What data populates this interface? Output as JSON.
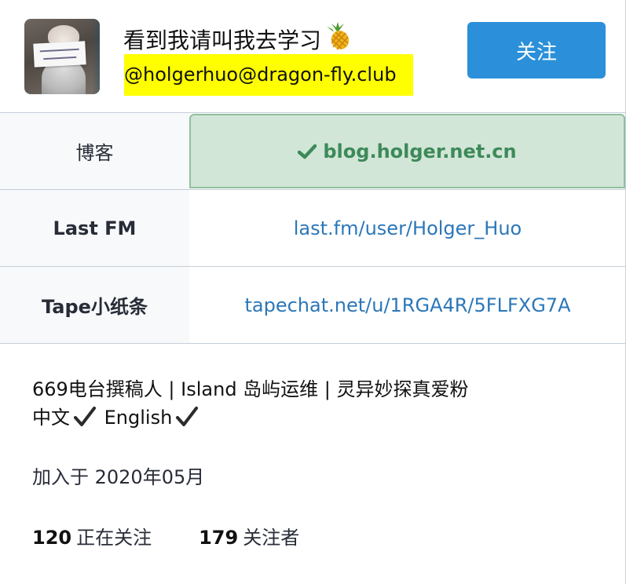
{
  "profile": {
    "display_name": "看到我请叫我去学习",
    "handle": "@holgerhuo@dragon-fly.club",
    "follow_label": "关注"
  },
  "fields": [
    {
      "name": "博客",
      "value": "blog.holger.net.cn",
      "verified": true
    },
    {
      "name": "Last FM",
      "value": "last.fm/user/Holger_Huo",
      "verified": false
    },
    {
      "name": "Tape小纸条",
      "value": "tapechat.net/u/1RGA4R/5FLFXG7A",
      "verified": false
    }
  ],
  "bio": {
    "line1": "669电台撰稿人 | Island 岛屿运维 | 灵异妙探真爱粉",
    "line2_a": "中文",
    "line2_b": "English"
  },
  "joined": "加入于 2020年05月",
  "stats": {
    "following_count": "120",
    "following_label": "正在关注",
    "followers_count": "179",
    "followers_label": "关注者"
  },
  "colors": {
    "accent": "#2b90d9",
    "link": "#2b77b9",
    "verified_bg": "#d2e6d8",
    "verified_text": "#3d8a59",
    "handle_highlight": "#ffff00"
  },
  "icons": [
    "pineapple-icon",
    "check-icon",
    "heavy-check-icon"
  ]
}
